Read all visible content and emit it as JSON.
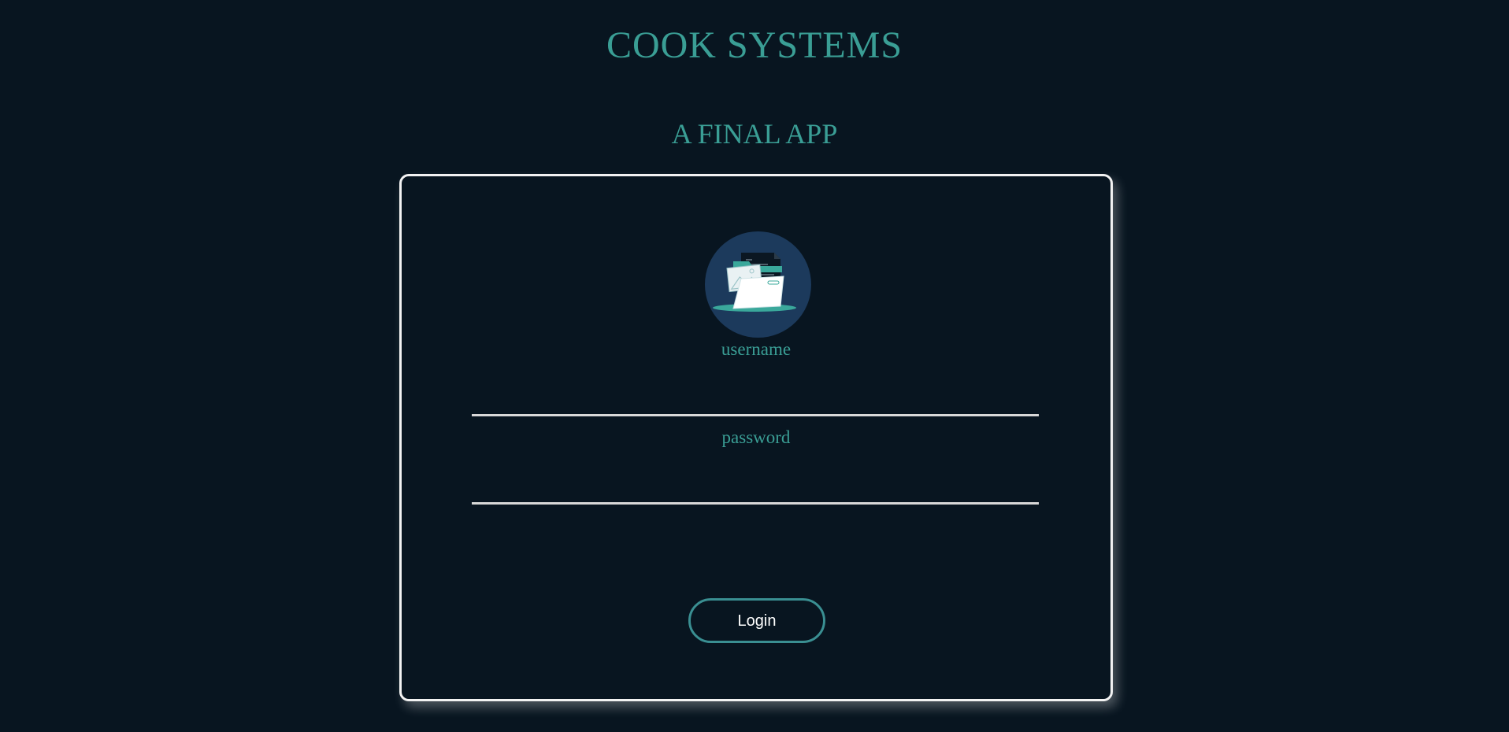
{
  "header": {
    "title": "COOK SYSTEMS",
    "subtitle": "A FINAL APP"
  },
  "login_form": {
    "avatar_icon": "folder-documents-icon",
    "username_label": "username",
    "username_value": "",
    "password_label": "password",
    "password_value": "",
    "login_button_label": "Login"
  },
  "colors": {
    "background": "#081520",
    "accent": "#3a9e95",
    "card_border": "#f2f2f2",
    "avatar_bg": "#1c3a5c",
    "button_border": "#3a8f92"
  }
}
